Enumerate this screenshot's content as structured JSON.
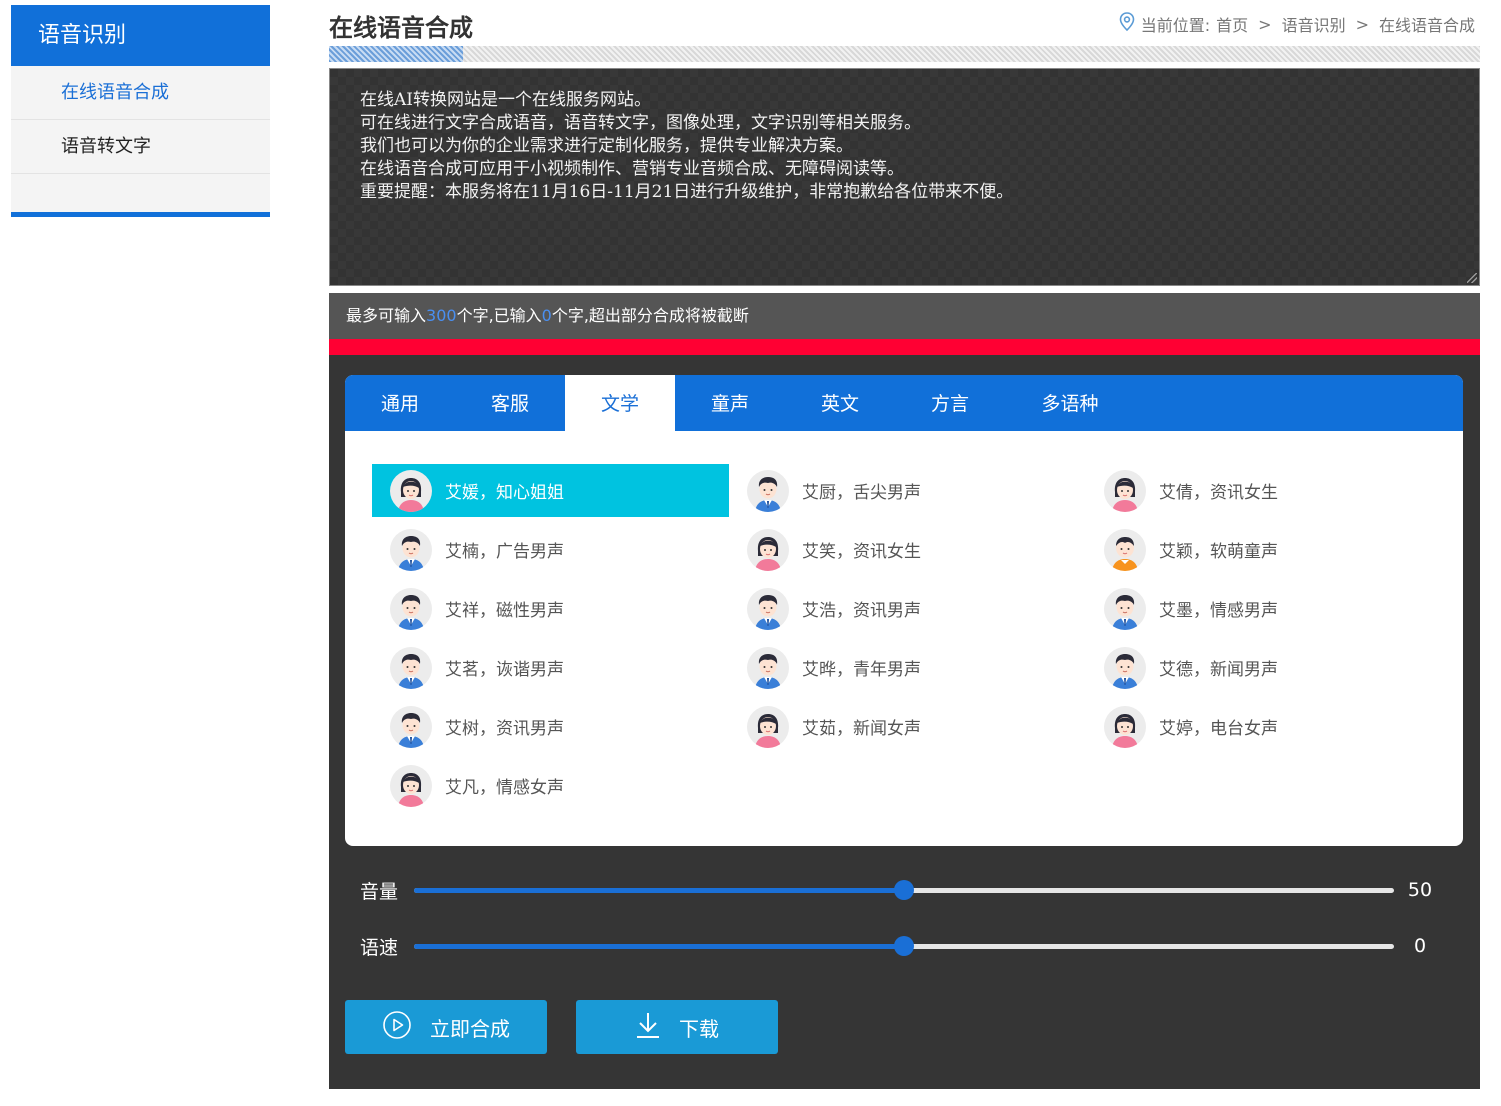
{
  "sidebar": {
    "title": "语音识别",
    "items": [
      {
        "label": "在线语音合成"
      },
      {
        "label": "语音转文字"
      }
    ]
  },
  "header": {
    "title": "在线语音合成",
    "breadcrumb": {
      "prefix": "当前位置:",
      "items": [
        "首页",
        "语音识别",
        "在线语音合成"
      ],
      "separator": ">"
    }
  },
  "textbox": {
    "lines": [
      "在线AI转换网站是一个在线服务网站。",
      "可在线进行文字合成语音，语音转文字，图像处理，文字识别等相关服务。",
      "我们也可以为你的企业需求进行定制化服务，提供专业解决方案。",
      "在线语音合成可应用于小视频制作、营销专业音频合成、无障碍阅读等。",
      "重要提醒：本服务将在11月16日-11月21日进行升级维护，非常抱歉给各位带来不便。"
    ]
  },
  "counter": {
    "prefix": "最多可输入",
    "max": "300",
    "middle": "个字,已输入",
    "count": "0",
    "suffix": "个字,超出部分合成将被截断"
  },
  "tabs": [
    {
      "label": "通用"
    },
    {
      "label": "客服"
    },
    {
      "label": "文学"
    },
    {
      "label": "童声"
    },
    {
      "label": "英文"
    },
    {
      "label": "方言"
    },
    {
      "label": "多语种"
    }
  ],
  "active_tab": "文学",
  "voices": [
    {
      "label": "艾媛，知心姐姐",
      "gender": "female",
      "selected": true
    },
    {
      "label": "艾厨，舌尖男声",
      "gender": "male"
    },
    {
      "label": "艾倩，资讯女生",
      "gender": "female"
    },
    {
      "label": "艾楠，广告男声",
      "gender": "male"
    },
    {
      "label": "艾笑，资讯女生",
      "gender": "female"
    },
    {
      "label": "艾颖，软萌童声",
      "gender": "child"
    },
    {
      "label": "艾祥，磁性男声",
      "gender": "male"
    },
    {
      "label": "艾浩，资讯男声",
      "gender": "male"
    },
    {
      "label": "艾墨，情感男声",
      "gender": "male"
    },
    {
      "label": "艾茗，诙谐男声",
      "gender": "male"
    },
    {
      "label": "艾晔，青年男声",
      "gender": "male"
    },
    {
      "label": "艾德，新闻男声",
      "gender": "male"
    },
    {
      "label": "艾树，资讯男声",
      "gender": "male"
    },
    {
      "label": "艾茹，新闻女声",
      "gender": "female"
    },
    {
      "label": "艾婷，电台女声",
      "gender": "female"
    },
    {
      "label": "艾凡，情感女声",
      "gender": "female"
    }
  ],
  "sliders": {
    "volume": {
      "label": "音量",
      "value": "50",
      "fill_fraction": 0.5
    },
    "speed": {
      "label": "语速",
      "value": "0",
      "fill_fraction": 0.5
    }
  },
  "buttons": {
    "synthesize": "立即合成",
    "download": "下载"
  },
  "colors": {
    "primary": "#1170d9",
    "selected_voice": "#00c3e0",
    "button": "#1a9ad6",
    "warning_bar": "#ff0033",
    "counter_highlight": "#4a8ff0"
  },
  "icons": {
    "breadcrumb": "location-pin-icon",
    "synthesize": "play-circle-icon",
    "download": "download-icon"
  }
}
